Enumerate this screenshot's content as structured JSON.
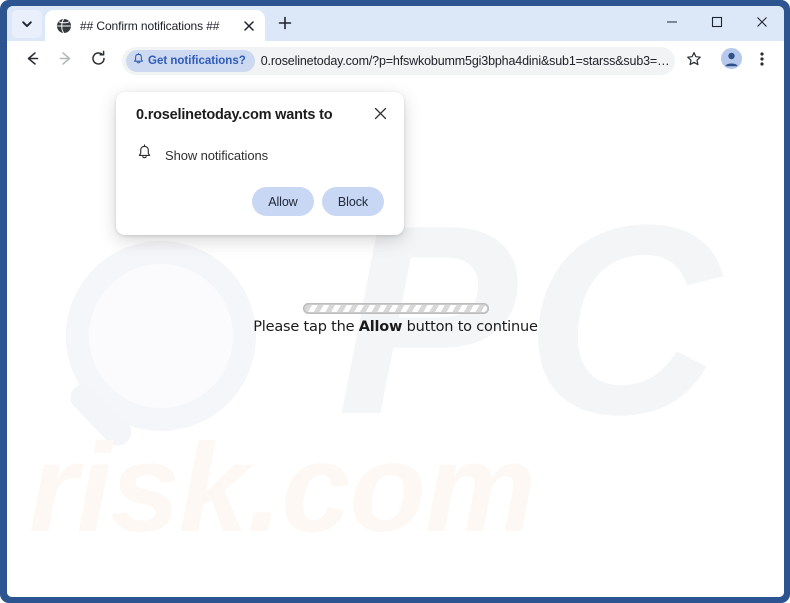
{
  "window": {
    "frame_color": "#2c5490",
    "controls": [
      {
        "name": "minimize",
        "glyph": "minimize-icon"
      },
      {
        "name": "maximize",
        "glyph": "maximize-icon"
      },
      {
        "name": "close",
        "glyph": "close-icon"
      }
    ]
  },
  "tabstrip": {
    "search_tabs_icon": "chevron-down-icon",
    "active_tab": {
      "favicon": "globe-icon",
      "title": "## Confirm notifications ##",
      "close_icon": "close-icon"
    },
    "new_tab_icon": "plus-icon"
  },
  "toolbar": {
    "back_icon": "arrow-left-icon",
    "forward_icon": "arrow-right-icon",
    "reload_icon": "reload-icon",
    "notifications_chip": {
      "icon": "bell-icon",
      "label": "Get notifications?",
      "background": "#cdd9f0",
      "text_color": "#2f5bb7"
    },
    "url": "0.roselinetoday.com/?p=hfswkobumm5gi3bpha4dini&sub1=starss&sub3=…",
    "bookmark_icon": "star-icon",
    "profile_icon": "avatar-icon",
    "menu_icon": "three-dots-vertical-icon"
  },
  "permission_dialog": {
    "title": "0.roselinetoday.com wants to",
    "close_icon": "close-icon",
    "permission": {
      "icon": "bell-icon",
      "label": "Show notifications"
    },
    "allow_label": "Allow",
    "block_label": "Block",
    "button_color": "#c8d7f3"
  },
  "page": {
    "loading_bar": {
      "name": "striped-progress-bar",
      "progress_percent": 100
    },
    "message_prefix": "Please tap the ",
    "message_emphasis": "Allow",
    "message_suffix": " button to continue",
    "watermarks": {
      "magnifier": "magnifying-glass-watermark",
      "pc_text": "PC",
      "risk_text": "risk.com"
    }
  }
}
